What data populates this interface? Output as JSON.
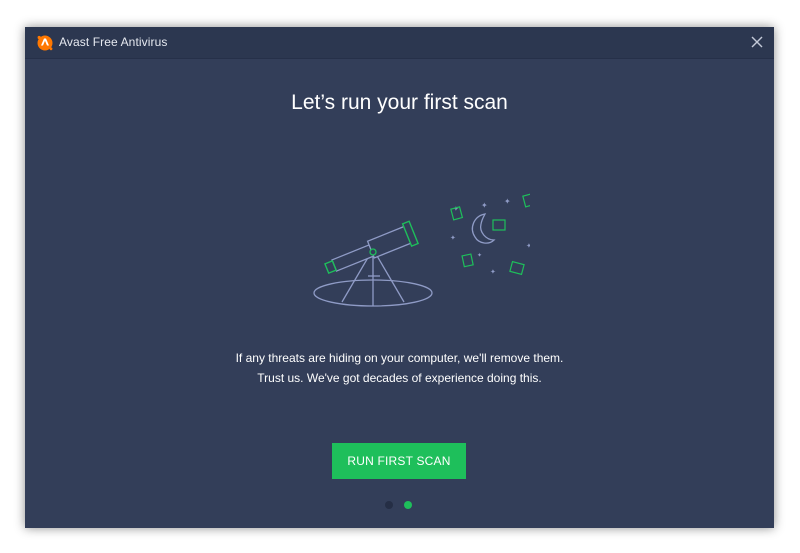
{
  "window": {
    "title": "Avast Free Antivirus"
  },
  "icons": {
    "logo": "avast-logo-icon",
    "close": "close-icon",
    "illustration": "telescope-stars-illustration"
  },
  "onboarding": {
    "headline": "Let’s run your first scan",
    "description_line1": "If any threats are hiding on your computer, we'll remove them.",
    "description_line2": "Trust us. We've got decades of experience doing this.",
    "primary_button_label": "RUN FIRST SCAN",
    "pager": {
      "total_pages": 2,
      "current_page": 2
    }
  },
  "colors": {
    "background": "#333e59",
    "titlebar": "#2c3750",
    "accent_green": "#1ebf5b",
    "logo_orange": "#ff7800",
    "illustration_line": "#8f9bc6",
    "inactive_dot": "#252e45"
  }
}
